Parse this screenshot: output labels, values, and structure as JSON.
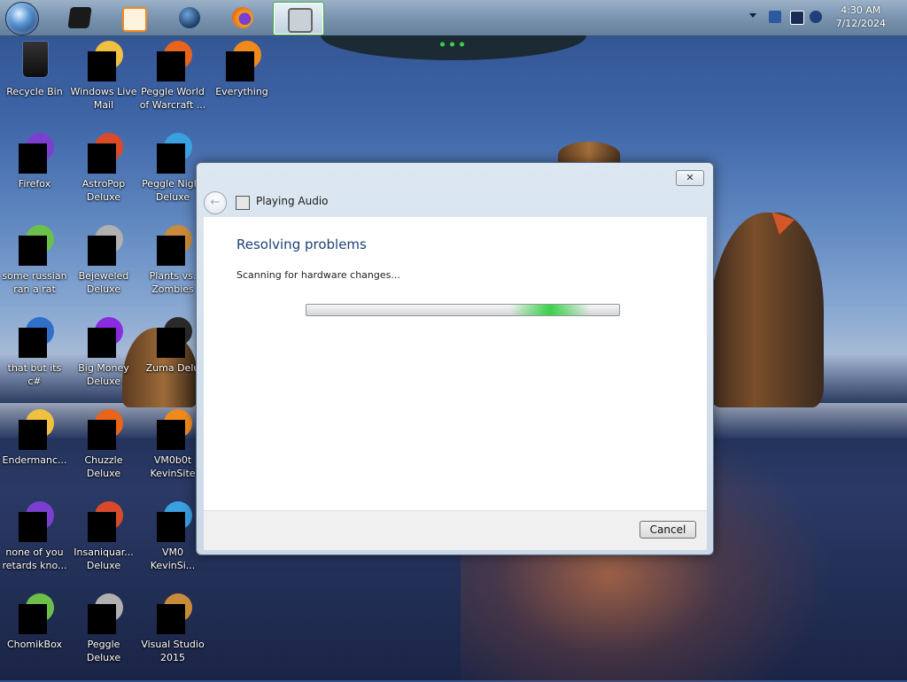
{
  "taskbar": {
    "clock_time": "4:30 AM",
    "clock_date": "7/12/2024",
    "pinned": [
      {
        "name": "start-orb"
      },
      {
        "name": "black-box-app-icon",
        "color": "#1a1a1a"
      },
      {
        "name": "media-player-icon",
        "color": "#f08a1c"
      },
      {
        "name": "globe-icon",
        "color": "#1b3b66"
      },
      {
        "name": "firefox-icon",
        "color": "#e8631b"
      },
      {
        "name": "troubleshooter-icon",
        "color": "#9aa3ad"
      }
    ]
  },
  "desktop": {
    "icons": [
      {
        "label": "Recycle Bin",
        "col": 0,
        "row": 0
      },
      {
        "label": "Windows Live\nMail",
        "col": 1,
        "row": 0
      },
      {
        "label": "Peggle World\nof Warcraft ...",
        "col": 2,
        "row": 0
      },
      {
        "label": "Everything",
        "col": 3,
        "row": 0
      },
      {
        "label": "Firefox",
        "col": 0,
        "row": 1
      },
      {
        "label": "AstroPop\nDeluxe",
        "col": 1,
        "row": 1
      },
      {
        "label": "Peggle Night\nDeluxe",
        "col": 2,
        "row": 1
      },
      {
        "label": "some russian\nran a rat",
        "col": 0,
        "row": 2
      },
      {
        "label": "Bejeweled\nDeluxe",
        "col": 1,
        "row": 2
      },
      {
        "label": "Plants vs.\nZombies",
        "col": 2,
        "row": 2
      },
      {
        "label": "that but its c#",
        "col": 0,
        "row": 3
      },
      {
        "label": "Big Money\nDeluxe",
        "col": 1,
        "row": 3
      },
      {
        "label": "Zuma Delu",
        "col": 2,
        "row": 3
      },
      {
        "label": "Endermanc...",
        "col": 0,
        "row": 4
      },
      {
        "label": "Chuzzle\nDeluxe",
        "col": 1,
        "row": 4
      },
      {
        "label": "VM0b0t\nKevinSite",
        "col": 2,
        "row": 4
      },
      {
        "label": "none of you\nretards kno...",
        "col": 0,
        "row": 5
      },
      {
        "label": "Insaniquar...\nDeluxe",
        "col": 1,
        "row": 5
      },
      {
        "label": "VM0\nKevinSi...",
        "col": 2,
        "row": 5
      },
      {
        "label": "ChomikBox",
        "col": 0,
        "row": 6
      },
      {
        "label": "Peggle Deluxe",
        "col": 1,
        "row": 6
      },
      {
        "label": "Visual Studio\n2015",
        "col": 2,
        "row": 6
      }
    ]
  },
  "dialog": {
    "close_label": "✕",
    "back_label": "←",
    "title": "Playing Audio",
    "heading": "Resolving problems",
    "status": "Scanning for hardware changes...",
    "cancel_label": "Cancel",
    "progress_state": "indeterminate"
  }
}
